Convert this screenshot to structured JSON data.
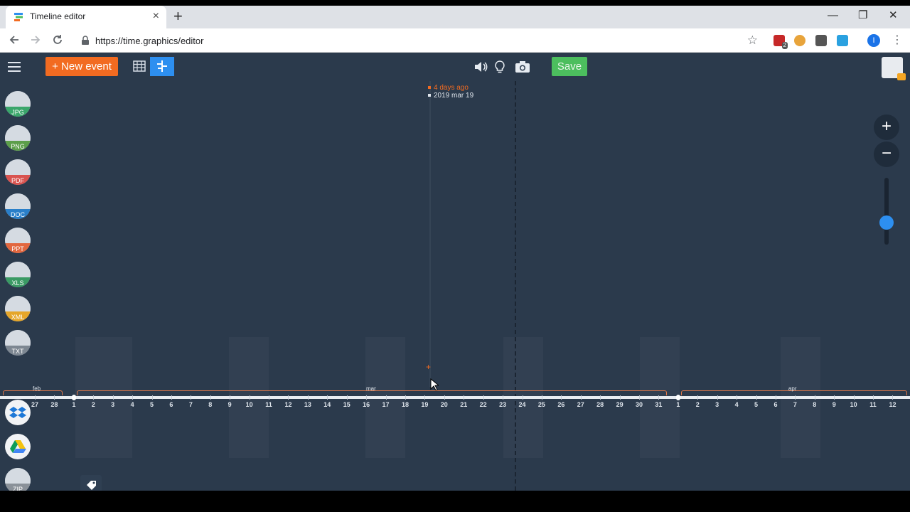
{
  "browser": {
    "tab_title": "Timeline editor",
    "tab_close": "×",
    "new_tab": "+",
    "url": "https://time.graphics/editor",
    "win_min": "—",
    "win_restore": "❐",
    "win_close": "✕",
    "profile_initial": "I",
    "ext_badge": "2"
  },
  "toolbar": {
    "new_event_label": "+ New event",
    "save_label": "Save",
    "icons": [
      "menu-icon",
      "table-view-icon",
      "timeline-view-icon",
      "speaker-icon",
      "lightbulb-icon",
      "camera-icon"
    ]
  },
  "sidebar": {
    "file_types": [
      {
        "label": "JPG",
        "color": "#3aa66b"
      },
      {
        "label": "PNG",
        "color": "#5c9e4a"
      },
      {
        "label": "PDF",
        "color": "#d9534f"
      },
      {
        "label": "DOC",
        "color": "#2a7fc9"
      },
      {
        "label": "PPT",
        "color": "#e2673f"
      },
      {
        "label": "XLS",
        "color": "#3a9a64"
      },
      {
        "label": "XML",
        "color": "#e5a62a"
      },
      {
        "label": "TXT",
        "color": "#7d8792"
      }
    ],
    "cloud": [
      "dropbox-icon",
      "google-drive-icon"
    ],
    "zip_label": "ZIP"
  },
  "cursor_readout": {
    "relative": "4 days ago",
    "absolute": "2019 mar 19"
  },
  "axis": {
    "months": [
      "feb",
      "mar",
      "apr"
    ],
    "days": [
      "27",
      "28",
      "1",
      "2",
      "3",
      "4",
      "5",
      "6",
      "7",
      "8",
      "9",
      "10",
      "11",
      "12",
      "13",
      "14",
      "15",
      "16",
      "17",
      "18",
      "19",
      "20",
      "21",
      "22",
      "23",
      "24",
      "25",
      "26",
      "27",
      "28",
      "29",
      "30",
      "31",
      "1",
      "2",
      "3",
      "4",
      "5",
      "6",
      "7",
      "8",
      "9",
      "10",
      "11",
      "12"
    ]
  },
  "zoom": {
    "plus": "+",
    "minus": "−",
    "level": 0.2
  },
  "colors": {
    "accent": "#f26b21",
    "save": "#4cbe5e",
    "background": "#2b3a4c",
    "slider": "#2d8ff0"
  }
}
